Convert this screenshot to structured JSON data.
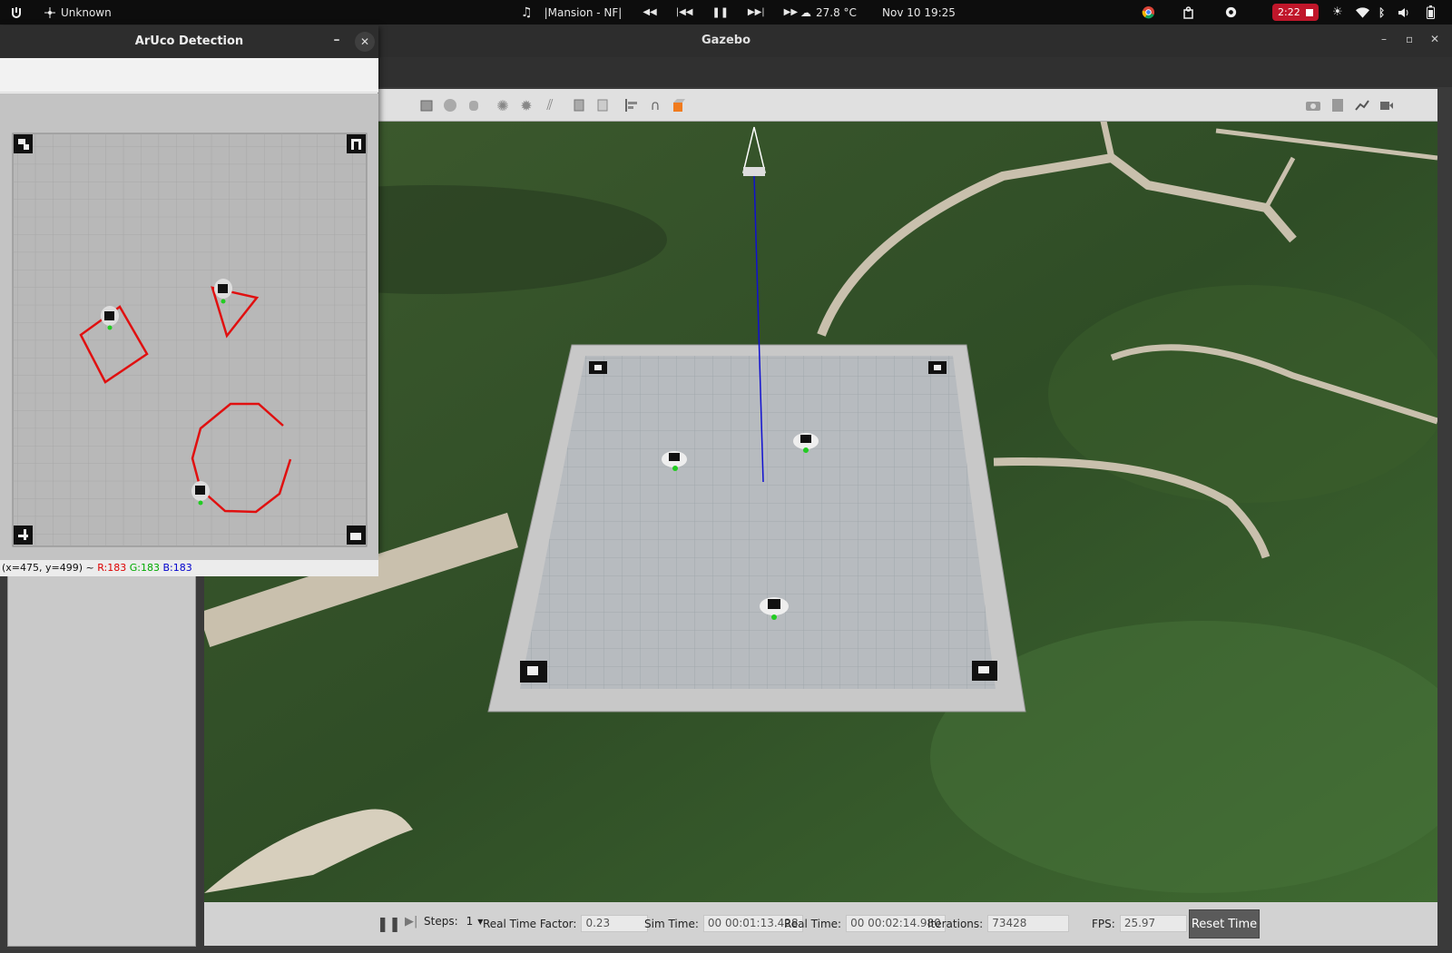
{
  "topbar": {
    "network_label": "Unknown",
    "media_title": "|Mansion - NF|",
    "temperature": "27.8 °C",
    "clock": "Nov 10  19:25",
    "record_time": "2:22"
  },
  "gazebo": {
    "title": "Gazebo",
    "bottom": {
      "steps_label": "Steps:",
      "steps_value": "1",
      "rtf_label": "Real Time Factor:",
      "rtf_value": "0.23",
      "sim_time_label": "Sim Time:",
      "sim_time_value": "00 00:01:13.428",
      "real_time_label": "Real Time:",
      "real_time_value": "00 00:02:14.980",
      "iterations_label": "Iterations:",
      "iterations_value": "73428",
      "fps_label": "FPS:",
      "fps_value": "25.97",
      "reset_label": "Reset Time"
    }
  },
  "aruco": {
    "title": "ArUco Detection",
    "status_coords": "(x=475, y=499) ~",
    "status_r": "R:183",
    "status_g": "G:183",
    "status_b": "B:183"
  },
  "colors": {
    "trajectory": "#e01010",
    "recording": "#c0162a",
    "axis_line": "#1010d0"
  }
}
